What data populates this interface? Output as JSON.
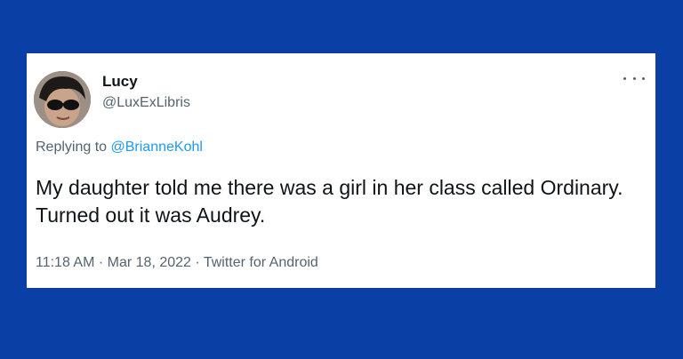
{
  "tweet": {
    "display_name": "Lucy",
    "handle": "@LuxExLibris",
    "replying_prefix": "Replying to ",
    "replying_to": "@BrianneKohl",
    "text": "My daughter told me there was a girl in her class called Ordinary. Turned out it was Audrey.",
    "time": "11:18 AM",
    "separator": " · ",
    "date": "Mar 18, 2022",
    "source": "Twitter for Android",
    "more_icon": "more-horizontal-icon"
  },
  "colors": {
    "background": "#0a3fa6",
    "card": "#ffffff",
    "text_primary": "#0f1419",
    "text_secondary": "#536471",
    "link": "#1d9bf0"
  }
}
